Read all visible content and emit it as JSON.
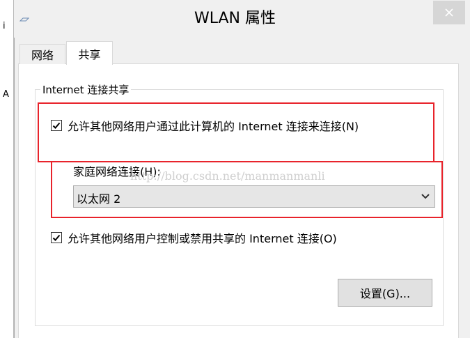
{
  "window": {
    "title": "WLAN 属性",
    "close_icon": "close-icon"
  },
  "background_fragments": {
    "frag1": "i",
    "frag2": "A"
  },
  "tabs": [
    {
      "label": "网络",
      "active": false
    },
    {
      "label": "共享",
      "active": true
    }
  ],
  "sharing": {
    "group_title": "Internet 连接共享",
    "allow_share": {
      "label": "允许其他网络用户通过此计算机的 Internet 连接来连接(N)",
      "checked": true
    },
    "home_network": {
      "label": "家庭网络连接(H):",
      "selected": "以太网 2"
    },
    "allow_control": {
      "label": "允许其他网络用户控制或禁用共享的 Internet 连接(O)",
      "checked": true
    },
    "settings_button": "设置(G)..."
  },
  "watermark": "http://blog.csdn.net/manmanmanli",
  "colors": {
    "highlight": "#e8232b",
    "panel": "#ffffff",
    "chrome": "#f0f0f0"
  }
}
